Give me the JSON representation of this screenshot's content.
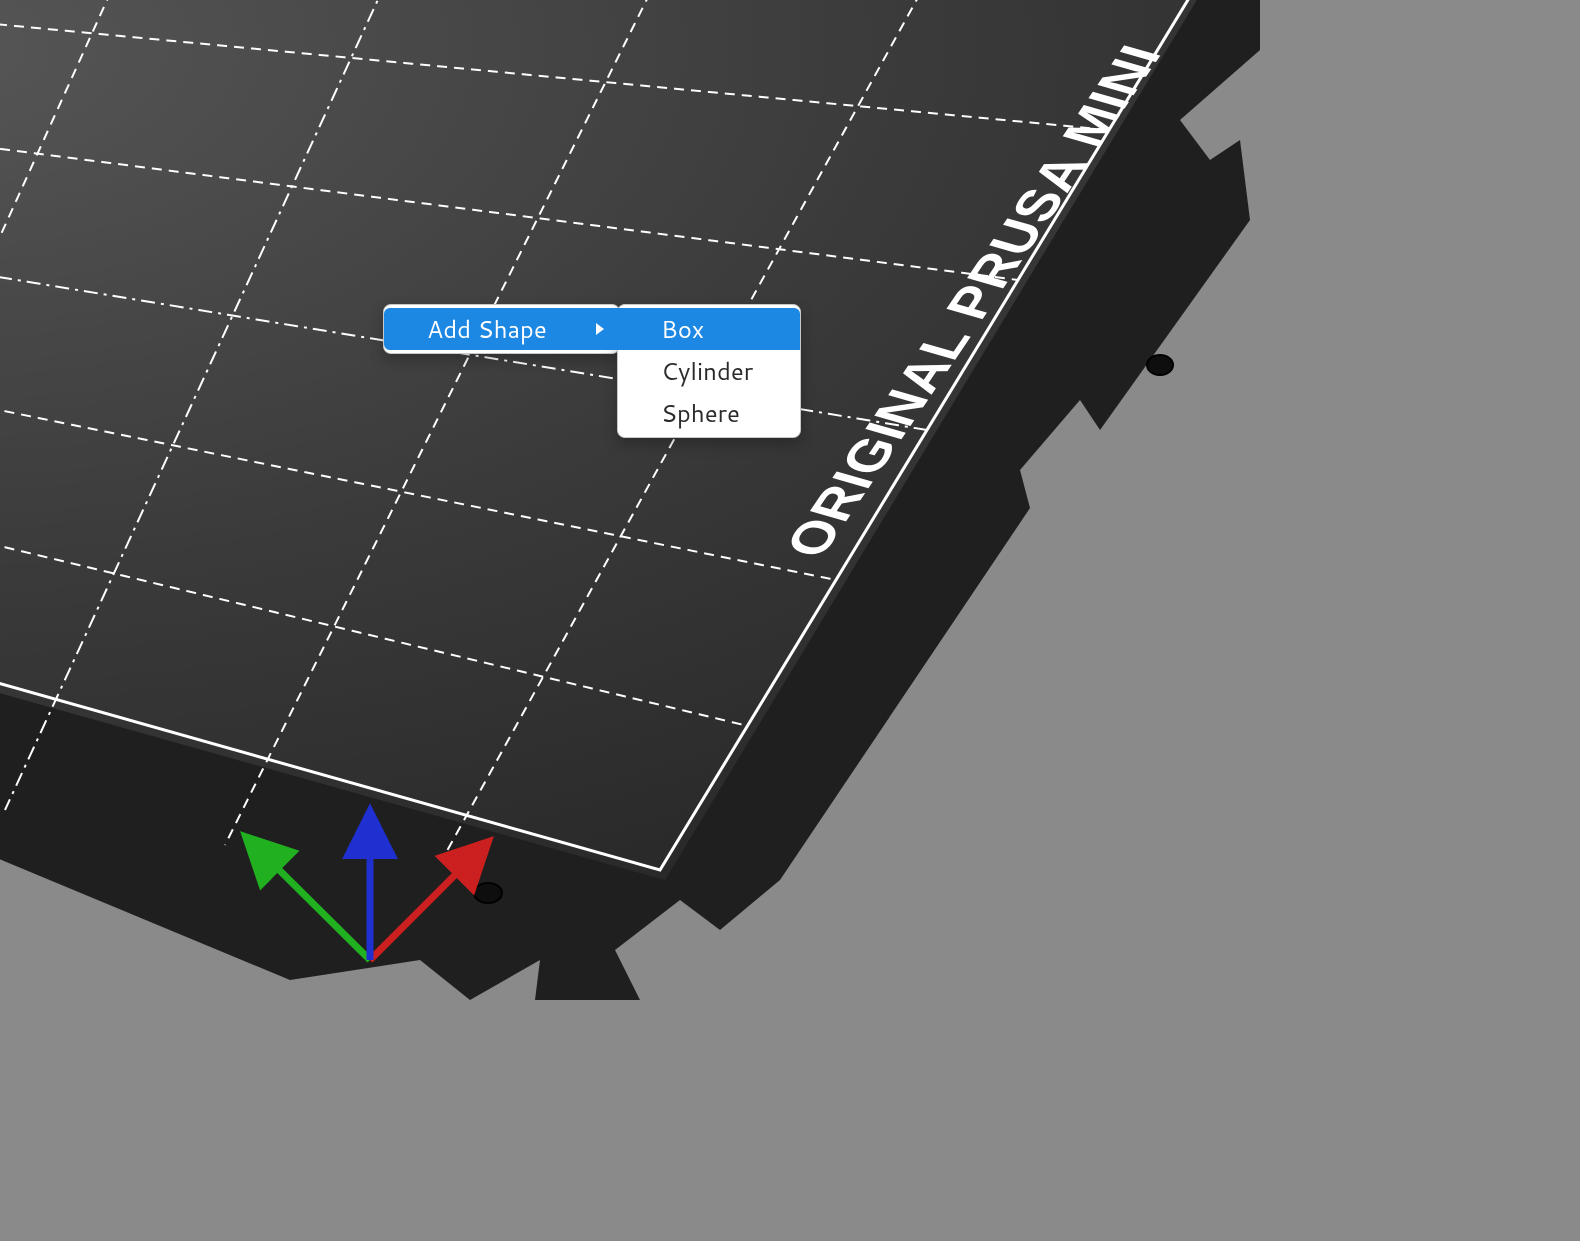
{
  "bed_label": "ORIGINAL PRUSA MINI",
  "context_menu": {
    "add_shape_label": "Add Shape",
    "submenu": {
      "box_label": "Box",
      "cylinder_label": "Cylinder",
      "sphere_label": "Sphere"
    }
  },
  "colors": {
    "highlight": "#1d87e4",
    "menu_bg": "#ffffff",
    "menu_text": "#2b2b2b",
    "viewport_bg": "#8a8a8a",
    "axis_x": "#cc2020",
    "axis_y": "#20b020",
    "axis_z": "#2030d0"
  }
}
